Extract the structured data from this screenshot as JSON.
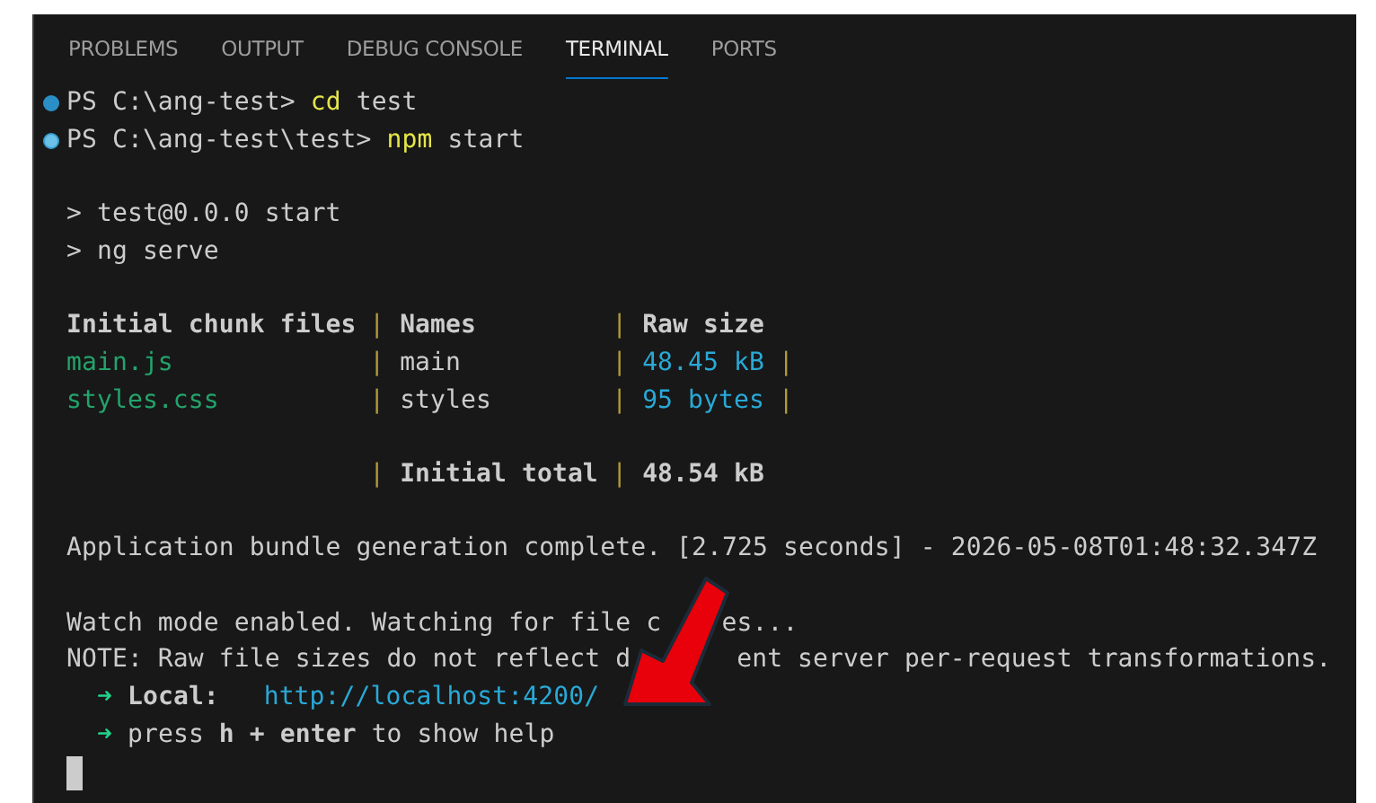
{
  "tabs": [
    {
      "label": "PROBLEMS",
      "selected": false
    },
    {
      "label": "OUTPUT",
      "selected": false
    },
    {
      "label": "DEBUG CONSOLE",
      "selected": false
    },
    {
      "label": "TERMINAL",
      "selected": true
    },
    {
      "label": "PORTS",
      "selected": false
    }
  ],
  "prompts": [
    {
      "dot_filled": true,
      "path": "PS C:\\ang-test>",
      "command": "cd",
      "args": "test"
    },
    {
      "dot_filled": false,
      "path": "PS C:\\ang-test\\test>",
      "command": "npm",
      "args": "start"
    }
  ],
  "script_lines": [
    "> test@0.0.0 start",
    "> ng serve"
  ],
  "table": {
    "separator": "|",
    "columns": [
      "Initial chunk files",
      "Names",
      "Raw size"
    ],
    "rows": [
      {
        "file": "main.js",
        "name": "main",
        "size": "48.45 kB"
      },
      {
        "file": "styles.css",
        "name": "styles",
        "size": "95 bytes"
      }
    ],
    "total_label": "Initial total",
    "total_value": "48.54 kB"
  },
  "bundle_message": "Application bundle generation complete. [2.725 seconds] - 2026-05-08T01:48:32.347Z",
  "watch_message": [
    "Watch mode enabled. Watching for file c",
    "es..."
  ],
  "note_message": [
    "NOTE: Raw file sizes do not reflect d",
    "ent server per-request transformations."
  ],
  "server": {
    "arrow": "➜",
    "label": "Local:",
    "url": "http://localhost:4200/"
  },
  "help": {
    "arrow": "➜",
    "text": "press **h + enter** to show help"
  }
}
